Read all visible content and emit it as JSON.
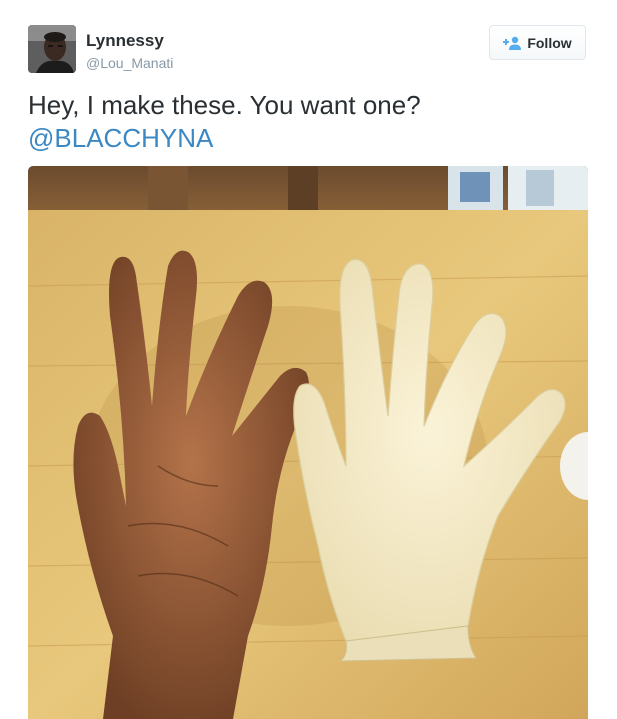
{
  "tweet": {
    "author": {
      "display_name": "Lynnessy",
      "screen_name": "@Lou_Manati",
      "avatar_icon": "profile-photo"
    },
    "follow_button": {
      "label": "Follow",
      "icon": "add-user-icon"
    },
    "text": "Hey, I make these. You want one?",
    "mention": "@BLACCHYNA",
    "media": {
      "description_icon": "photo-two-hands"
    }
  },
  "colors": {
    "text": "#292f33",
    "secondary_text": "#8899a6",
    "link": "#3b88c3",
    "follow_icon": "#55acee",
    "button_border": "#e1e8ed"
  }
}
